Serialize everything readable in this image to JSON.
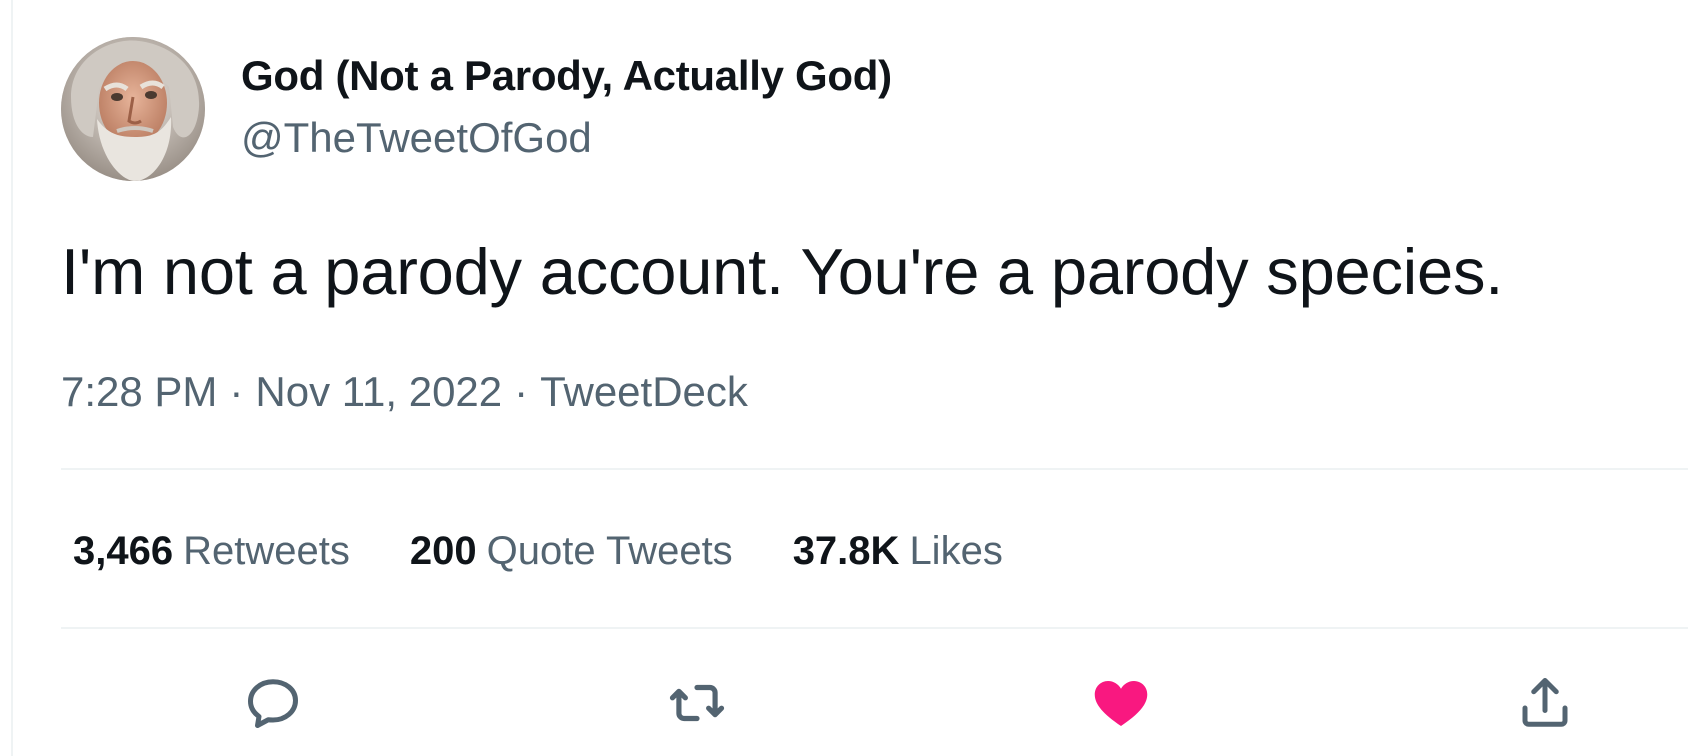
{
  "author": {
    "name": "God (Not a Parody, Actually God)",
    "handle": "@TheTweetOfGod",
    "avatar_icon": "bearded-man-avatar"
  },
  "tweet": {
    "text": "I'm not a parody account. You're a parody species.",
    "time": "7:28 PM",
    "separator": "·",
    "date": "Nov 11, 2022",
    "source": "TweetDeck"
  },
  "stats": {
    "retweets": {
      "count": "3,466",
      "label": "Retweets"
    },
    "quote_tweets": {
      "count": "200",
      "label": "Quote Tweets"
    },
    "likes": {
      "count": "37.8K",
      "label": "Likes"
    }
  },
  "actions": {
    "reply_icon": "reply-icon",
    "retweet_icon": "retweet-icon",
    "like_icon": "heart-icon",
    "share_icon": "share-icon"
  },
  "colors": {
    "text_primary": "#0f1419",
    "text_secondary": "#536471",
    "divider": "#eff3f4",
    "like_active": "#f91880",
    "icon_default": "#536471"
  }
}
